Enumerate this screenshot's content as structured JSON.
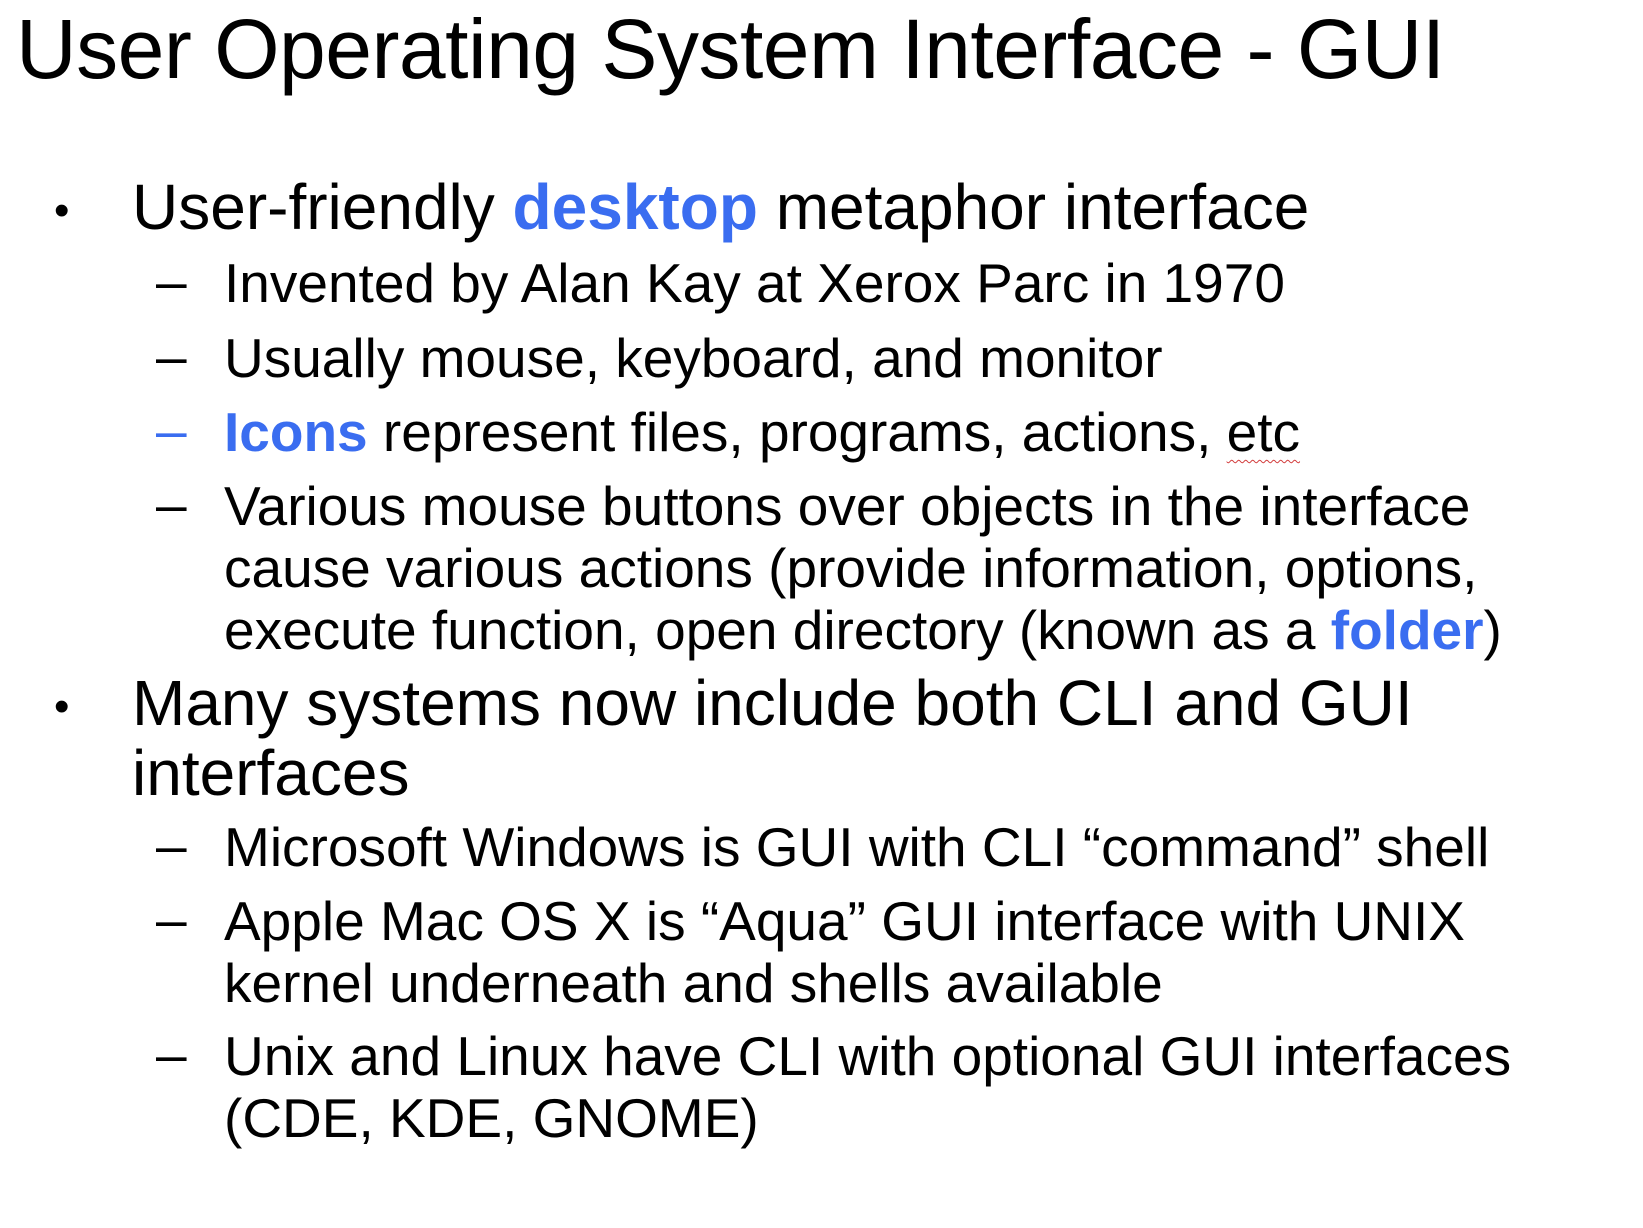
{
  "title": "User Operating System Interface - GUI",
  "colors": {
    "text": "#000000",
    "highlight": "#3a6df0",
    "spellcheck": "#d23b3b"
  },
  "bullets": [
    {
      "marker": "•",
      "before": "User-friendly ",
      "highlight": "desktop",
      "after": " metaphor interface",
      "subitems": [
        {
          "marker": "–",
          "text": "Invented by Alan Kay at Xerox Parc in 1970"
        },
        {
          "marker": "–",
          "text": "Usually mouse, keyboard, and monitor"
        },
        {
          "marker": "–",
          "highlight": "Icons",
          "text": " represent files, programs, actions, ",
          "spell_word": "etc"
        },
        {
          "marker": "–",
          "lines": [
            "Various mouse buttons over objects in the interface",
            "cause various actions (provide information, options,",
            "execute function, open directory (known as a "
          ],
          "highlight": "folder",
          "after": ")"
        }
      ]
    },
    {
      "marker": "•",
      "lines": [
        "Many systems now include both CLI and GUI",
        "interfaces"
      ],
      "subitems": [
        {
          "marker": "–",
          "text": "Microsoft Windows is GUI with CLI “command” shell"
        },
        {
          "marker": "–",
          "lines": [
            "Apple Mac OS X is “Aqua” GUI interface with UNIX",
            "kernel underneath and shells available"
          ]
        },
        {
          "marker": "–",
          "lines": [
            "Unix and Linux have CLI with optional GUI interfaces",
            "(CDE, KDE, GNOME)"
          ]
        }
      ]
    }
  ]
}
